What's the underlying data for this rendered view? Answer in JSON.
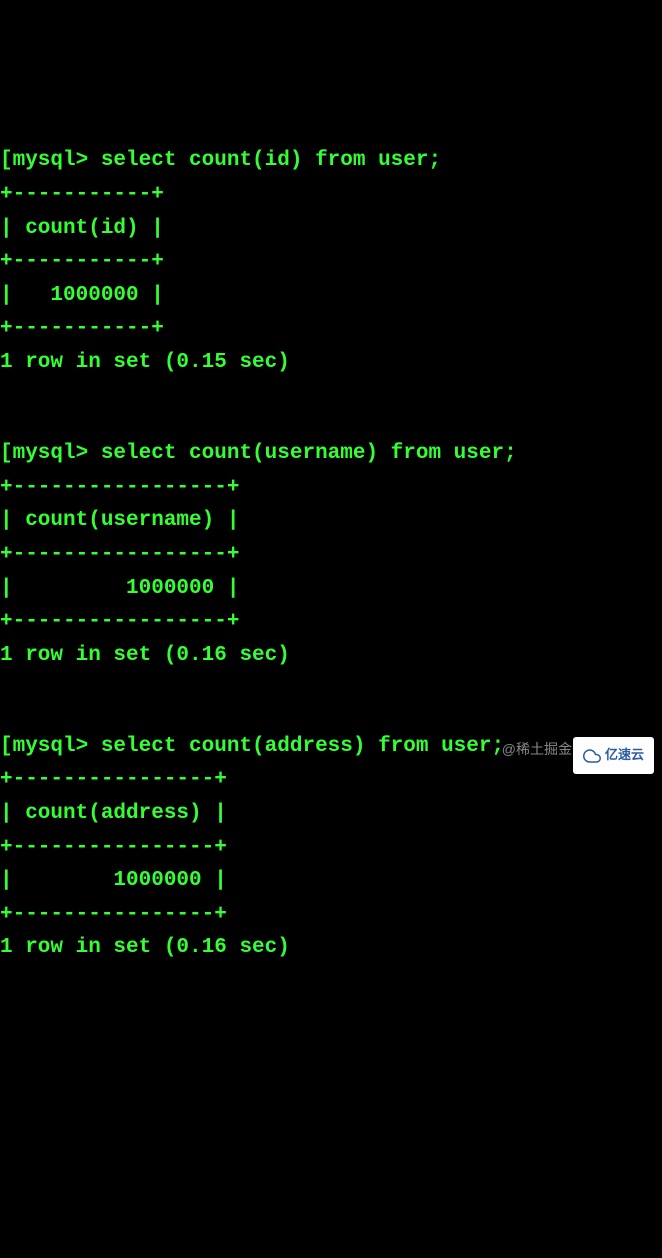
{
  "queries": [
    {
      "prompt": "[mysql> ",
      "sql": "select count(id) from user;",
      "border_top": "+-----------+",
      "header": "| count(id) |",
      "border_mid": "+-----------+",
      "row": "|   1000000 |",
      "border_bot": "+-----------+",
      "status": "1 row in set (0.15 sec)"
    },
    {
      "prompt": "[mysql> ",
      "sql": "select count(username) from user;",
      "border_top": "+-----------------+",
      "header": "| count(username) |",
      "border_mid": "+-----------------+",
      "row": "|         1000000 |",
      "border_bot": "+-----------------+",
      "status": "1 row in set (0.16 sec)"
    },
    {
      "prompt": "[mysql> ",
      "sql": "select count(address) from user;",
      "border_top": "+----------------+",
      "header": "| count(address) |",
      "border_mid": "+----------------+",
      "row": "|        1000000 |",
      "border_bot": "+----------------+",
      "status": "1 row in set (0.16 sec)"
    }
  ],
  "watermark_text": "@稀土掘金",
  "watermark_logo": "亿速云"
}
